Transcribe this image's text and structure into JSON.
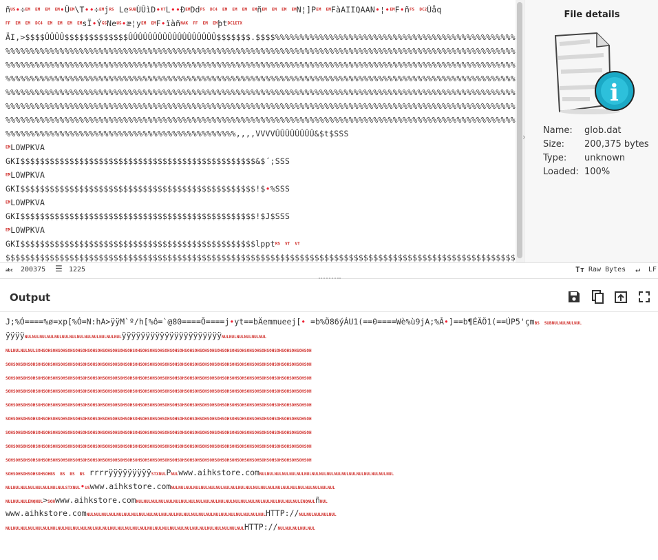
{
  "input": {
    "lines": [
      "ñUS•÷EM EM EM EM•ÜEM\\T••÷EMjRS LeSUBÙÛìD•VTL••ÐEMDdFS DC4 EM EM EM EMñEM EM EM EMN¦]PEM EMFàAIIQAAN•¦•EMF•ñFS DC2Ùåq",
      "FF EM EM DC4 EM EM EM EMsÏ•ÝGSNeUS•æ¦yEM EMF•ïàñNAK FF EM EMþtDC1ETX",
      "ÄI,>$$$$ÛÛÛÛ$$$$$$$$$$$$$ÛÛÛÛÛÛÛÛÛÛÛÛÛÛÛÛÛÛ$$$$$$$.$$$$%%%%%%%%%%%%%%%%%%%%%%%%%%%%%%%%%%%%%%%%%%%%%%%%%%%%%%%%%%%%%%%",
      "%%%%%%%%%%%%%%%%%%%%%%%%%%%%%%%%%%%%%%%%%%%%%%%%%%%%%%%%%%%%%%%%%%%%%%%%%%%%%%%%%%%%%%%%%%%%%%%%%%%%%%%%%%%%%%%%%%%%%",
      "%%%%%%%%%%%%%%%%%%%%%%%%%%%%%%%%%%%%%%%%%%%%%%%%%%%%%%%%%%%%%%%%%%%%%%%%%%%%%%%%%%%%%%%%%%%%%%%%%%%%%%%%%%%%%%%%%%%%%",
      "%%%%%%%%%%%%%%%%%%%%%%%%%%%%%%%%%%%%%%%%%%%%%%%%%%%%%%%%%%%%%%%%%%%%%%%%%%%%%%%%%%%%%%%%%%%%%%%%%%%%%%%%%%%%%%%%%%%%%",
      "%%%%%%%%%%%%%%%%%%%%%%%%%%%%%%%%%%%%%%%%%%%%%%%%%%%%%%%%%%%%%%%%%%%%%%%%%%%%%%%%%%%%%%%%%%%%%%%%%%%%%%%%%%%%%%%%%%%%%",
      "%%%%%%%%%%%%%%%%%%%%%%%%%%%%%%%%%%%%%%%%%%%%%%%%%%%%%%%%%%%%%%%%%%%%%%%%%%%%%%%%%%%%%%%%%%%%%%%%%%%%%%%%%%%%%%%%%%%%%",
      "%%%%%%%%%%%%%%%%%%%%%%%%%%%%%%%%%%%%%%%%%%%%%%%%%%%%%%%%%%%%%%%%%%%%%%%%%%%%%%%%%%%%%%%%%%%%%%%%%%%%%%%%%%%%%%%%%%%%%",
      "%%%%%%%%%%%%%%%%%%%%%%%%%%%%%%%%%%%%%%%%%%%%%%%,,,,VVVVÛÛÛÛÛÛÛÛ&$t$SSS",
      "EMLOWPKVA",
      "GKI$$$$$$$$$$$$$$$$$$$$$$$$$$$$$$$$$$$$$$$$$$$$$$$$&$´;SSS",
      "EMLOWPKVA",
      "GKI$$$$$$$$$$$$$$$$$$$$$$$$$$$$$$$$$$$$$$$$$$$$$$$$!$•%SSS",
      "EMLOWPKVA",
      "GKI$$$$$$$$$$$$$$$$$$$$$$$$$$$$$$$$$$$$$$$$$$$$$$$$!$J$SSS",
      "EMLOWPKVA",
      "GKI$$$$$$$$$$$$$$$$$$$$$$$$$$$$$$$$$$$$$$$$$$$$$$$$lpptRS VT VT",
      "$$$$$$$$$$$$$$$$$$$$$$$$$$$$$$$$$$$$$$$$$$$$$$$$$$$$$$$$$$$$$$$$$$$$$$$$$$$$$$$$$$$$$$$$$$$$$$$$$$$$$$$$$$$$$$$$$$$$$$$"
    ]
  },
  "file_details": {
    "title": "File details",
    "name_label": "Name:",
    "name_value": "glob.dat",
    "size_label": "Size:",
    "size_value": "200,375 bytes",
    "type_label": "Type:",
    "type_value": "unknown",
    "loaded_label": "Loaded:",
    "loaded_value": "100%"
  },
  "status": {
    "length_icon": "abc",
    "length": "200375",
    "lines": "1225",
    "raw_bytes": "Raw Bytes",
    "eol": "LF"
  },
  "output": {
    "title": "Output",
    "lines": [
      "J;%Ó====%ø=xp[%Ó=N:hA>ÿÿM`º/h[%ô=`@80====Õ====j•yt==bÄemmueej[•  =b%Ö86ýÁU1(==0====Wè%ù9jA;%Â•]==b¶ÉÄÖ1(==ÚP5'çmBS SUBNULNULNULNUL",
      "ÿÿÿÿNULNULNULNULNULNULNULNULNULNULNULNULNULÿÿÿÿÿÿÿÿÿÿÿÿÿÿÿÿÿÿÿÿÿNULNULNULNULNULNUL",
      "NULNULNULNULSOHSOHSOHSOHSOHSOHSOHSOHSOHSOHSOHSOHSOHSOHSOHSOHSOHSOHSOHSOHSOHSOHSOHSOHSOHSOHSOHSOHSOHSOHSOHSOHSOHSOHSOHSOHSOH",
      "SOHSOHSOHSOHSOHSOHSOHSOHSOHSOHSOHSOHSOHSOHSOHSOHSOHSOHSOHSOHSOHSOHSOHSOHSOHSOHSOHSOHSOHSOHSOHSOHSOHSOHSOHSOHSOHSOHSOHSOHSOH",
      "SOHSOHSOHSOHSOHSOHSOHSOHSOHSOHSOHSOHSOHSOHSOHSOHSOHSOHSOHSOHSOHSOHSOHSOHSOHSOHSOHSOHSOHSOHSOHSOHSOHSOHSOHSOHSOHSOHSOHSOHSOH",
      "SOHSOHSOHSOHSOHSOHSOHSOHSOHSOHSOHSOHSOHSOHSOHSOHSOHSOHSOHSOHSOHSOHSOHSOHSOHSOHSOHSOHSOHSOHSOHSOHSOHSOHSOHSOHSOHSOHSOHSOHSOH",
      "SOHSOHSOHSOHSOHSOHSOHSOHSOHSOHSOHSOHSOHSOHSOHSOHSOHSOHSOHSOHSOHSOHSOHSOHSOHSOHSOHSOHSOHSOHSOHSOHSOHSOHSOHSOHSOHSOHSOHSOHSOH",
      "SOHSOHSOHSOHSOHSOHSOHSOHSOHSOHSOHSOHSOHSOHSOHSOHSOHSOHSOHSOHSOHSOHSOHSOHSOHSOHSOHSOHSOHSOHSOHSOHSOHSOHSOHSOHSOHSOHSOHSOHSOH",
      "SOHSOHSOHSOHSOHSOHSOHSOHSOHSOHSOHSOHSOHSOHSOHSOHSOHSOHSOHSOHSOHSOHSOHSOHSOHSOHSOHSOHSOHSOHSOHSOHSOHSOHSOHSOHSOHSOHSOHSOHSOH",
      "SOHSOHSOHSOHSOHSOHSOHSOHSOHSOHSOHSOHSOHSOHSOHSOHSOHSOHSOHSOHSOHSOHSOHSOHSOHSOHSOHSOHSOHSOHSOHSOHSOHSOHSOHSOHSOHSOHSOHSOHSOH",
      "SOHSOHSOHSOHSOHSOHSOHSOHSOHSOHSOHSOHSOHSOHSOHSOHSOHSOHSOHSOHSOHSOHSOHSOHSOHSOHSOHSOHSOHSOHSOHSOHSOHSOHSOHSOHSOHSOHSOHSOHSOH",
      "SOHSOHSOHSOHSOHSOHBS BS BS BS rrrrÿÿÿÿÿÿÿÿÿSTXNULPNULwww.aihkstore.comNULNULNULNULNULNULNULNULNULNULNULNULNULNULNULNULNULNUL",
      "NULNULNULNULNULNULNULNULSTXNUL•USwww.aihkstore.comNULNULNULNULNULNULNULNULNULNULNULNULNULNULNULNULNULNULNULNULNULNUL",
      "NULNULNULENQNUL>SOHwww.aihkstore.comNULNULNULNULNULNULNULNULNULNULNULNULNULNULNULNULNULNULNULNULNULNULENQNULñNUL",
      "www.aihkstore.comNULNULNULNULNULNULNULNULNULNULNULNULNULNULNULNULNULNULNULNULNULNULNULNULHTTP://NULNULNULNULNUL",
      "NULNULNULNULNULNULNULNULNULNULNULNULNULNULNULNULNULNULNULNULNULNULNULNULNULNULNULNULNULNULNULNULHTTP://NULNULNULNULNUL"
    ]
  }
}
